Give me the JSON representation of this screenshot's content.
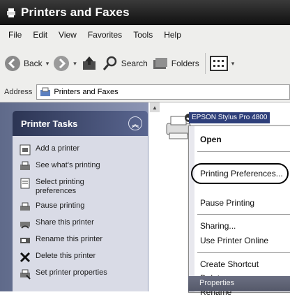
{
  "window": {
    "title": "Printers and Faxes"
  },
  "menubar": {
    "items": [
      "File",
      "Edit",
      "View",
      "Favorites",
      "Tools",
      "Help"
    ]
  },
  "toolbar": {
    "back_label": "Back",
    "search_label": "Search",
    "folders_label": "Folders"
  },
  "address": {
    "label": "Address",
    "value": "Printers and Faxes"
  },
  "taskpane": {
    "title": "Printer Tasks",
    "items": [
      {
        "label": "Add a printer",
        "icon": "add-printer-icon"
      },
      {
        "label": "See what's printing",
        "icon": "print-queue-icon"
      },
      {
        "label": "Select printing preferences",
        "icon": "document-icon"
      },
      {
        "label": "Pause printing",
        "icon": "pause-printer-icon"
      },
      {
        "label": "Share this printer",
        "icon": "share-printer-icon"
      },
      {
        "label": "Rename this printer",
        "icon": "rename-icon"
      },
      {
        "label": "Delete this printer",
        "icon": "delete-x-icon"
      },
      {
        "label": "Set printer properties",
        "icon": "properties-icon"
      }
    ]
  },
  "content": {
    "printer_name": "EPSON Stylus Pro 4800"
  },
  "context_menu": {
    "open": "Open",
    "printing_preferences": "Printing Preferences...",
    "pause_printing": "Pause Printing",
    "sharing": "Sharing...",
    "use_printer_online": "Use Printer Online",
    "create_shortcut": "Create Shortcut",
    "delete": "Delete",
    "rename": "Rename",
    "properties": "Properties"
  },
  "colors": {
    "titlebar": "#1a1a1a",
    "selection": "#2e3f7a",
    "taskpane_header": "#2c3554"
  }
}
